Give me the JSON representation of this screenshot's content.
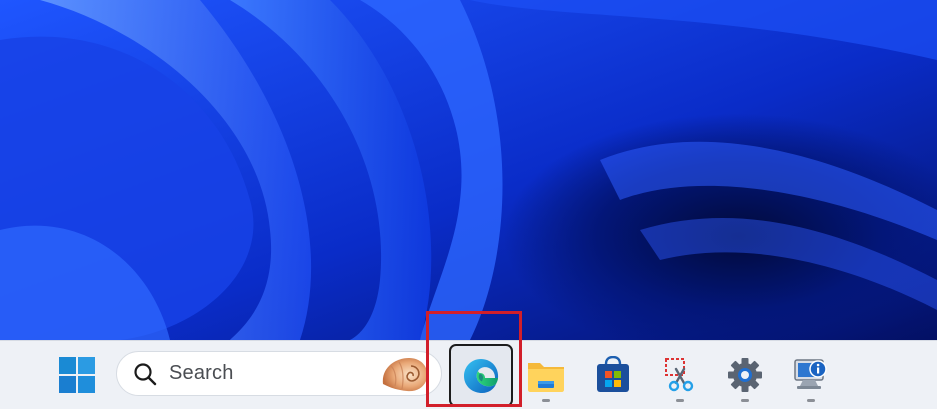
{
  "taskbar": {
    "start_icon": "windows-logo-icon",
    "search": {
      "label": "Search",
      "icon": "magnifier-icon",
      "highlight_icon": "nautilus-shell-icon"
    },
    "pinned_apps": [
      {
        "icon": "edge-icon",
        "running": false,
        "highlighted": true
      },
      {
        "icon": "file-explorer-icon",
        "running": true
      },
      {
        "icon": "microsoft-store-icon",
        "running": false
      },
      {
        "icon": "snipping-tool-icon",
        "running": true
      },
      {
        "icon": "settings-gear-icon",
        "running": true
      },
      {
        "icon": "system-information-icon",
        "running": true
      }
    ]
  },
  "colors": {
    "taskbar_bg": "#eef1f6",
    "highlight_frame": "#d21f2a",
    "windows_blue": "#1a8ad4"
  }
}
